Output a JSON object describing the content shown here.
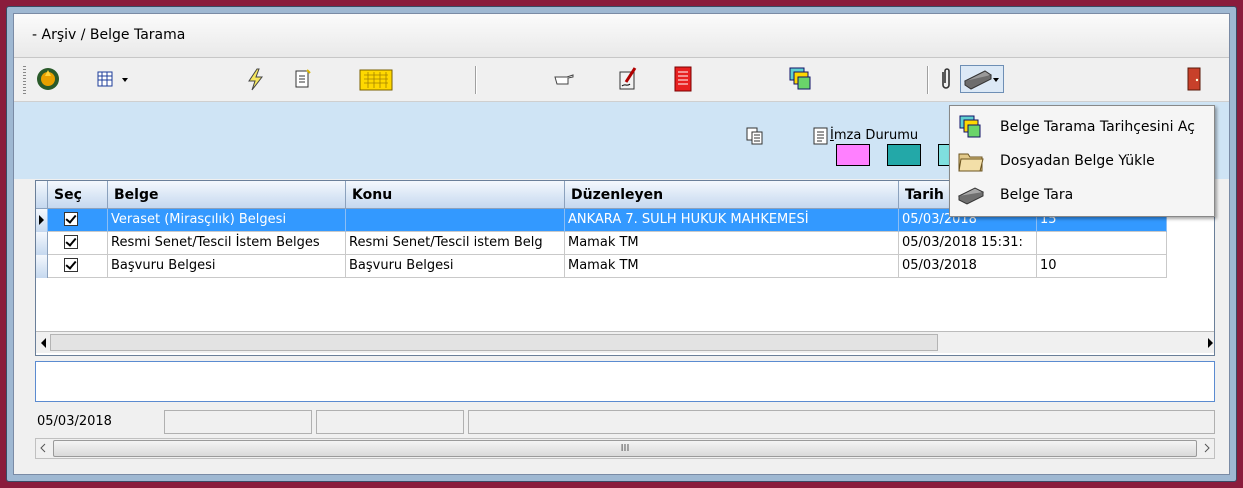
{
  "window": {
    "title": "- Arşiv / Belge Tarama"
  },
  "toolbar": {
    "icons": [
      "stamp-icon",
      "calendar-grid-icon",
      "lightning-icon",
      "document-edit-icon",
      "folder-grid-icon",
      "pointing-hand-icon",
      "sign-document-icon",
      "red-document-icon",
      "scan-history-icon",
      "paperclip-icon",
      "scanner-icon",
      "exit-door-icon"
    ]
  },
  "info": {
    "imza_label": "İmza Durumu",
    "swatch_colors": [
      "#ff80ff",
      "#23a8a8",
      "#7fdfdf"
    ]
  },
  "grid": {
    "columns": [
      "Seç",
      "Belge",
      "Konu",
      "Düzenleyen",
      "Tarih",
      ""
    ],
    "rows": [
      {
        "sec": true,
        "belge": "Veraset (Mirasçılık) Belgesi",
        "konu": "",
        "duzenleyen": "ANKARA 7. SULH HUKUK MAHKEMESİ",
        "tarih": "05/03/2018",
        "extra": "15"
      },
      {
        "sec": true,
        "belge": "Resmi Senet/Tescil İstem Belges",
        "konu": "Resmi Senet/Tescil istem Belg",
        "duzenleyen": "Mamak TM",
        "tarih": "05/03/2018 15:31:",
        "extra": ""
      },
      {
        "sec": true,
        "belge": "Başvuru Belgesi",
        "konu": "Başvuru Belgesi",
        "duzenleyen": "Mamak TM",
        "tarih": "05/03/2018",
        "extra": "10"
      }
    ]
  },
  "status": {
    "date": "05/03/2018",
    "scroll_mark": "III"
  },
  "menu": {
    "items": [
      "Belge Tarama Tarihçesini Aç",
      "Dosyadan Belge Yükle",
      "Belge Tara"
    ]
  },
  "colors": {
    "selection": "#3399ff",
    "frame": "#8a1c3c"
  }
}
